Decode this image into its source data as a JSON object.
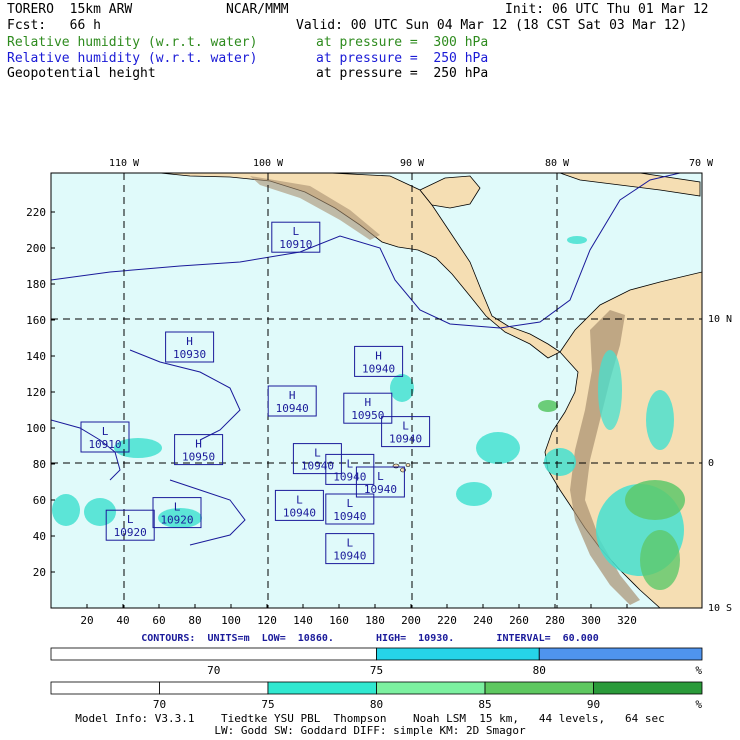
{
  "header": {
    "model": "TORERO  15km ARW",
    "center": "NCAR/MMM",
    "init": "Init: 06 UTC Thu 01 Mar 12",
    "fcst": "Fcst:   66 h",
    "valid": "Valid: 00 UTC Sun 04 Mar 12 (18 CST Sat 03 Mar 12)",
    "fields": [
      {
        "name": "Relative humidity (w.r.t. water)",
        "level": "at pressure =  300 hPa",
        "color": "#2e8b1e"
      },
      {
        "name": "Relative humidity (w.r.t. water)",
        "level": "at pressure =  250 hPa",
        "color": "#1a1ad6"
      },
      {
        "name": "Geopotential height",
        "level": "at pressure =  250 hPa",
        "color": "#000000"
      }
    ]
  },
  "map": {
    "lon_labels": [
      "110 W",
      "100 W",
      "90 W",
      "80 W",
      "70 W"
    ],
    "lat_labels": [
      "10 N",
      "0",
      "10 S"
    ],
    "x_ticks": [
      "20",
      "40",
      "60",
      "80",
      "100",
      "120",
      "140",
      "160",
      "180",
      "200",
      "220",
      "240",
      "260",
      "280",
      "300",
      "320"
    ],
    "y_ticks": [
      "220",
      "200",
      "180",
      "160",
      "140",
      "120",
      "100",
      "80",
      "60",
      "40",
      "20"
    ],
    "colors": {
      "ocean": "#e0fafa",
      "land": "#f5deb3",
      "mountain": "#a89070",
      "grid": "#000000",
      "rh_high": "#44e0d0",
      "rh_mid": "#5ec86a",
      "isoline": "#1a1a9a"
    },
    "systems": [
      {
        "type": "L",
        "value": "10910",
        "gx": 136,
        "gy": 206
      },
      {
        "type": "H",
        "value": "10930",
        "gx": 77,
        "gy": 145
      },
      {
        "type": "H",
        "value": "10940",
        "gx": 134,
        "gy": 115
      },
      {
        "type": "L",
        "value": "10910",
        "gx": 30,
        "gy": 95
      },
      {
        "type": "H",
        "value": "10950",
        "gx": 82,
        "gy": 88
      },
      {
        "type": "L",
        "value": "10940",
        "gx": 148,
        "gy": 83
      },
      {
        "type": "L",
        "value": "10940",
        "gx": 166,
        "gy": 77
      },
      {
        "type": "L",
        "value": "10920",
        "gx": 70,
        "gy": 53
      },
      {
        "type": "L",
        "value": "10920",
        "gx": 44,
        "gy": 46
      },
      {
        "type": "L",
        "value": "10940",
        "gx": 138,
        "gy": 57
      },
      {
        "type": "L",
        "value": "10940",
        "gx": 166,
        "gy": 55
      },
      {
        "type": "L",
        "value": "10940",
        "gx": 166,
        "gy": 33
      },
      {
        "type": "L",
        "value": "10940",
        "gx": 183,
        "gy": 70
      },
      {
        "type": "H",
        "value": "10950",
        "gx": 176,
        "gy": 111
      },
      {
        "type": "H",
        "value": "10940",
        "gx": 182,
        "gy": 137
      },
      {
        "type": "L",
        "value": "10940",
        "gx": 197,
        "gy": 98
      }
    ]
  },
  "contours": "CONTOURS:  UNITS=m  LOW=  10860.       HIGH=  10930.       INTERVAL=  60.000",
  "bar300": {
    "color": "#1a1ad6",
    "ticks": [
      "70",
      "75",
      "80"
    ],
    "unit": "%",
    "segments": [
      {
        "from": 0,
        "to": 0.5,
        "color": "#ffffff"
      },
      {
        "from": 0.5,
        "to": 0.75,
        "color": "#26d4e8"
      },
      {
        "from": 0.75,
        "to": 1.0,
        "color": "#4f94ee"
      }
    ]
  },
  "bar250": {
    "ticks": [
      "70",
      "75",
      "80",
      "85",
      "90"
    ],
    "unit": "%",
    "segments": [
      {
        "from": 0,
        "to": 0.1667,
        "color": "#ffffff"
      },
      {
        "from": 0.1667,
        "to": 0.3333,
        "color": "#ffffff"
      },
      {
        "from": 0.3333,
        "to": 0.5,
        "color": "#30e8d0"
      },
      {
        "from": 0.5,
        "to": 0.6667,
        "color": "#7cf0a0"
      },
      {
        "from": 0.6667,
        "to": 0.8333,
        "color": "#5ec860"
      },
      {
        "from": 0.8333,
        "to": 1.0,
        "color": "#2a9a3a"
      }
    ]
  },
  "footer": {
    "line1": "Model Info: V3.3.1    Tiedtke YSU PBL  Thompson    Noah LSM  15 km,   44 levels,   64 sec",
    "line2": "LW: Godd SW: Goddard DIFF: simple KM: 2D Smagor"
  }
}
